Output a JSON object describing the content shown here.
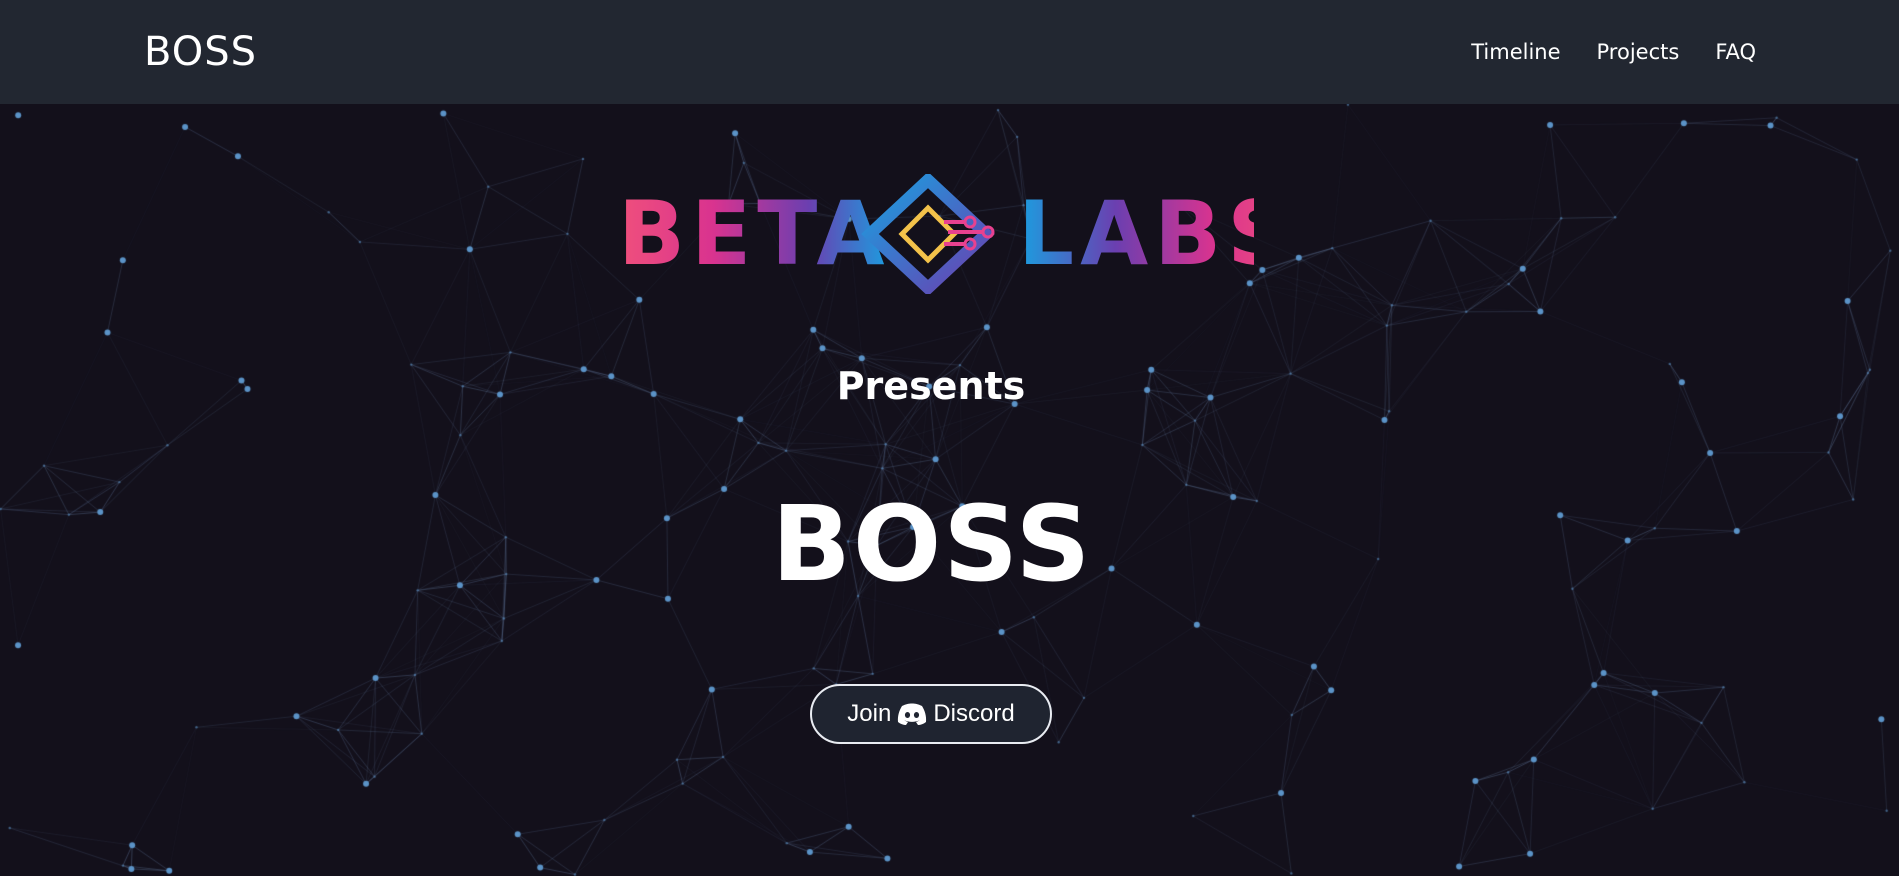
{
  "navbar": {
    "brand": "BOSS",
    "links": [
      {
        "label": "Timeline"
      },
      {
        "label": "Projects"
      },
      {
        "label": "FAQ"
      }
    ]
  },
  "hero": {
    "logo_text_left": "BETA",
    "logo_text_right": "LABS",
    "presents": "Presents",
    "title": "BOSS",
    "discord_button": {
      "label_before": "Join",
      "icon": "discord-icon",
      "label_after": "Discord"
    }
  },
  "colors": {
    "navbar_bg": "#222731",
    "page_bg": "#13101b",
    "network_line": "#3c4a63",
    "network_node": "#5b93c7",
    "logo_pink": "#e8418f",
    "logo_purple": "#6b3fb0",
    "logo_blue": "#1a9fe0",
    "logo_yellow": "#f3c24a"
  }
}
